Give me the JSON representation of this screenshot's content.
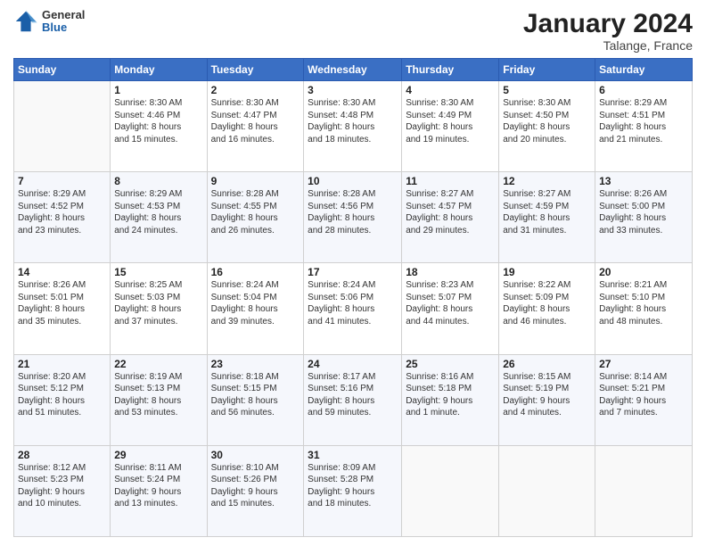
{
  "header": {
    "logo": {
      "general": "General",
      "blue": "Blue"
    },
    "title": "January 2024",
    "location": "Talange, France"
  },
  "weekdays": [
    "Sunday",
    "Monday",
    "Tuesday",
    "Wednesday",
    "Thursday",
    "Friday",
    "Saturday"
  ],
  "weeks": [
    [
      {
        "day": "",
        "info": ""
      },
      {
        "day": "1",
        "info": "Sunrise: 8:30 AM\nSunset: 4:46 PM\nDaylight: 8 hours\nand 15 minutes."
      },
      {
        "day": "2",
        "info": "Sunrise: 8:30 AM\nSunset: 4:47 PM\nDaylight: 8 hours\nand 16 minutes."
      },
      {
        "day": "3",
        "info": "Sunrise: 8:30 AM\nSunset: 4:48 PM\nDaylight: 8 hours\nand 18 minutes."
      },
      {
        "day": "4",
        "info": "Sunrise: 8:30 AM\nSunset: 4:49 PM\nDaylight: 8 hours\nand 19 minutes."
      },
      {
        "day": "5",
        "info": "Sunrise: 8:30 AM\nSunset: 4:50 PM\nDaylight: 8 hours\nand 20 minutes."
      },
      {
        "day": "6",
        "info": "Sunrise: 8:29 AM\nSunset: 4:51 PM\nDaylight: 8 hours\nand 21 minutes."
      }
    ],
    [
      {
        "day": "7",
        "info": ""
      },
      {
        "day": "8",
        "info": "Sunrise: 8:29 AM\nSunset: 4:53 PM\nDaylight: 8 hours\nand 24 minutes."
      },
      {
        "day": "9",
        "info": "Sunrise: 8:28 AM\nSunset: 4:55 PM\nDaylight: 8 hours\nand 26 minutes."
      },
      {
        "day": "10",
        "info": "Sunrise: 8:28 AM\nSunset: 4:56 PM\nDaylight: 8 hours\nand 28 minutes."
      },
      {
        "day": "11",
        "info": "Sunrise: 8:27 AM\nSunset: 4:57 PM\nDaylight: 8 hours\nand 29 minutes."
      },
      {
        "day": "12",
        "info": "Sunrise: 8:27 AM\nSunset: 4:59 PM\nDaylight: 8 hours\nand 31 minutes."
      },
      {
        "day": "13",
        "info": "Sunrise: 8:26 AM\nSunset: 5:00 PM\nDaylight: 8 hours\nand 33 minutes."
      }
    ],
    [
      {
        "day": "14",
        "info": ""
      },
      {
        "day": "15",
        "info": "Sunrise: 8:25 AM\nSunset: 5:03 PM\nDaylight: 8 hours\nand 37 minutes."
      },
      {
        "day": "16",
        "info": "Sunrise: 8:24 AM\nSunset: 5:04 PM\nDaylight: 8 hours\nand 39 minutes."
      },
      {
        "day": "17",
        "info": "Sunrise: 8:24 AM\nSunset: 5:06 PM\nDaylight: 8 hours\nand 41 minutes."
      },
      {
        "day": "18",
        "info": "Sunrise: 8:23 AM\nSunset: 5:07 PM\nDaylight: 8 hours\nand 44 minutes."
      },
      {
        "day": "19",
        "info": "Sunrise: 8:22 AM\nSunset: 5:09 PM\nDaylight: 8 hours\nand 46 minutes."
      },
      {
        "day": "20",
        "info": "Sunrise: 8:21 AM\nSunset: 5:10 PM\nDaylight: 8 hours\nand 48 minutes."
      }
    ],
    [
      {
        "day": "21",
        "info": ""
      },
      {
        "day": "22",
        "info": "Sunrise: 8:19 AM\nSunset: 5:13 PM\nDaylight: 8 hours\nand 53 minutes."
      },
      {
        "day": "23",
        "info": "Sunrise: 8:18 AM\nSunset: 5:15 PM\nDaylight: 8 hours\nand 56 minutes."
      },
      {
        "day": "24",
        "info": "Sunrise: 8:17 AM\nSunset: 5:16 PM\nDaylight: 8 hours\nand 59 minutes."
      },
      {
        "day": "25",
        "info": "Sunrise: 8:16 AM\nSunset: 5:18 PM\nDaylight: 9 hours\nand 1 minute."
      },
      {
        "day": "26",
        "info": "Sunrise: 8:15 AM\nSunset: 5:19 PM\nDaylight: 9 hours\nand 4 minutes."
      },
      {
        "day": "27",
        "info": "Sunrise: 8:14 AM\nSunset: 5:21 PM\nDaylight: 9 hours\nand 7 minutes."
      }
    ],
    [
      {
        "day": "28",
        "info": ""
      },
      {
        "day": "29",
        "info": "Sunrise: 8:11 AM\nSunset: 5:24 PM\nDaylight: 9 hours\nand 13 minutes."
      },
      {
        "day": "30",
        "info": "Sunrise: 8:10 AM\nSunset: 5:26 PM\nDaylight: 9 hours\nand 15 minutes."
      },
      {
        "day": "31",
        "info": "Sunrise: 8:09 AM\nSunset: 5:28 PM\nDaylight: 9 hours\nand 18 minutes."
      },
      {
        "day": "",
        "info": ""
      },
      {
        "day": "",
        "info": ""
      },
      {
        "day": "",
        "info": ""
      }
    ]
  ],
  "sunday_infos": [
    "Sunrise: 8:29 AM\nSunset: 4:52 PM\nDaylight: 8 hours\nand 23 minutes.",
    "Sunrise: 8:26 AM\nSunset: 5:01 PM\nDaylight: 8 hours\nand 35 minutes.",
    "Sunrise: 8:20 AM\nSunset: 5:12 PM\nDaylight: 8 hours\nand 51 minutes.",
    "Sunrise: 8:12 AM\nSunset: 5:23 PM\nDaylight: 9 hours\nand 10 minutes."
  ]
}
